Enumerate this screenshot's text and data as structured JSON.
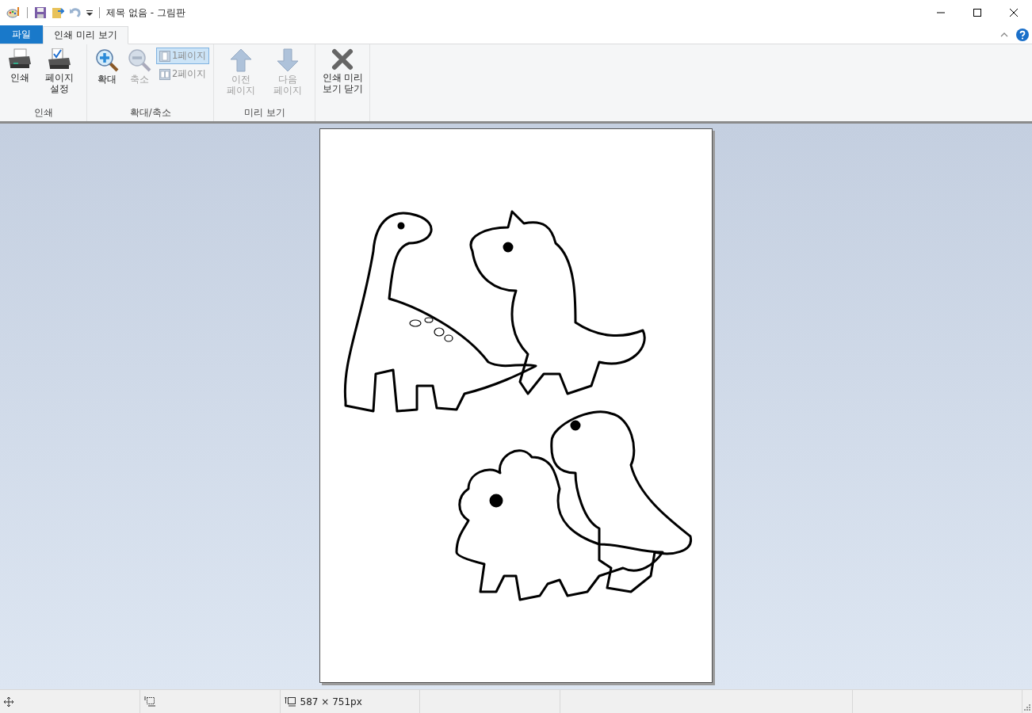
{
  "window": {
    "title": "제목 없음 - 그림판"
  },
  "tabs": [
    {
      "label": "파일",
      "kind": "file",
      "selected": false
    },
    {
      "label": "인쇄 미리 보기",
      "kind": "tab",
      "selected": true
    }
  ],
  "ribbon_groups": [
    {
      "label": "인쇄",
      "buttons": [
        {
          "kind": "large",
          "label": "인쇄",
          "disabled": false
        },
        {
          "kind": "large",
          "label": "페이지 설정",
          "disabled": false
        }
      ]
    },
    {
      "label": "확대/축소",
      "buttons": [
        {
          "kind": "large",
          "label": "확대",
          "disabled": false
        },
        {
          "kind": "large",
          "label": "축소",
          "disabled": true
        },
        {
          "kind": "stack",
          "items": [
            {
              "label": "1페이지",
              "selected": true
            },
            {
              "label": "2페이지",
              "selected": false
            }
          ]
        }
      ]
    },
    {
      "label": "미리 보기",
      "buttons": [
        {
          "kind": "large",
          "label": "이전 페이지",
          "disabled": true
        },
        {
          "kind": "large",
          "label": "다음 페이지",
          "disabled": true
        }
      ]
    },
    {
      "buttons": [
        {
          "kind": "large",
          "label": "인쇄 미리 보기 닫기",
          "disabled": false
        }
      ]
    }
  ],
  "status_bar": {
    "size": "587 × 751px"
  }
}
